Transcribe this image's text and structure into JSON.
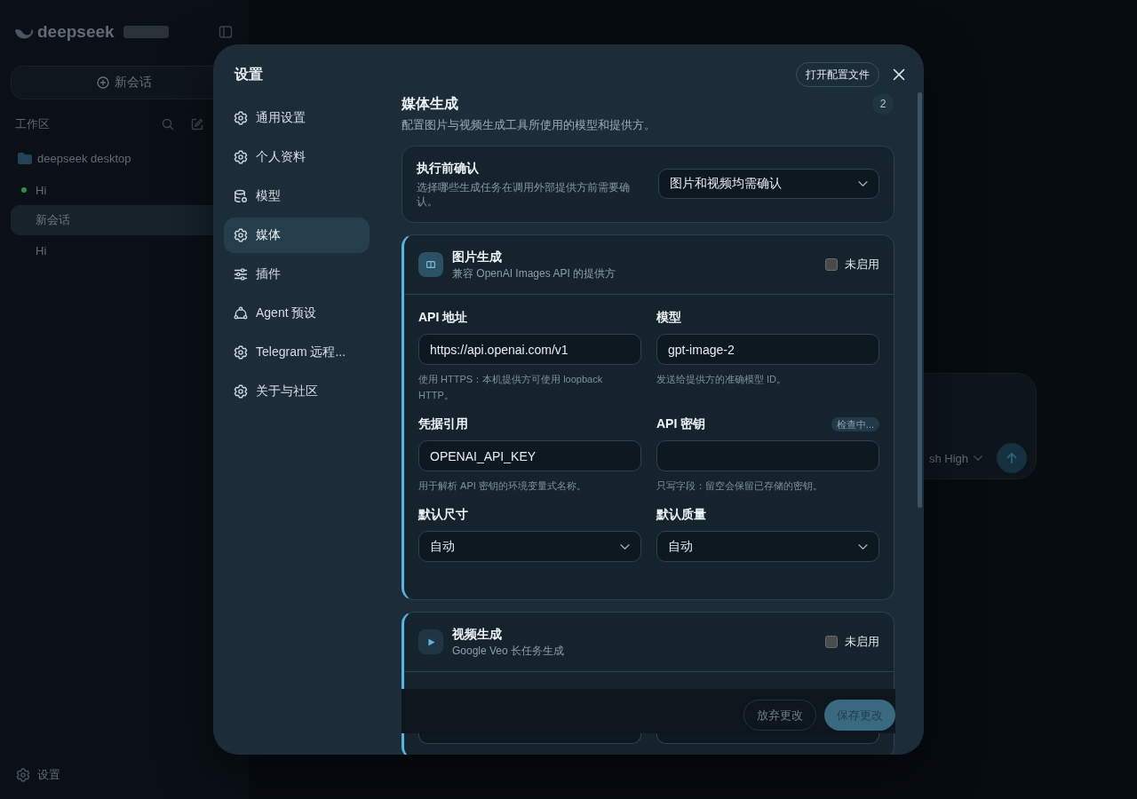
{
  "background": {
    "sidebar": {
      "brand": "deepseek",
      "new_chat_button": "新会话",
      "section_title": "工作区",
      "project": "deepseek desktop",
      "conversations": [
        {
          "title": "Hi",
          "selected": false,
          "color": "#2f8f3f"
        },
        {
          "title": "新会话",
          "selected": true
        },
        {
          "title": "Hi",
          "selected": false
        }
      ],
      "settings_link": "设置"
    },
    "composer": {
      "model_selector": "sh High"
    }
  },
  "dialog": {
    "title": "设置",
    "nav": [
      {
        "kind": "gear",
        "label": "通用设置",
        "selected": false
      },
      {
        "kind": "gear",
        "label": "个人资料",
        "selected": false
      },
      {
        "kind": "database",
        "label": "模型",
        "selected": false
      },
      {
        "kind": "gear",
        "label": "媒体",
        "selected": true
      },
      {
        "kind": "sliders",
        "label": "插件",
        "selected": false
      },
      {
        "kind": "cycle",
        "label": "Agent 预设",
        "selected": false
      },
      {
        "kind": "gear",
        "label": "Telegram 远程...",
        "selected": false
      },
      {
        "kind": "gear",
        "label": "关于与社区",
        "selected": false
      }
    ],
    "open_config_button": "打开配置文件",
    "section": {
      "title": "媒体生成",
      "description": "配置图片与视频生成工具所使用的模型和提供方。",
      "badge": "2"
    },
    "confirm_card": {
      "title": "执行前确认",
      "description": "选择哪些生成任务在调用外部提供方前需要确认。",
      "value": "图片和视频均需确认"
    },
    "providers": [
      {
        "kind": "image",
        "title": "图片生成",
        "subtitle": "兼容 OpenAI Images API 的提供方",
        "enabled": false,
        "enabled_label": "未启用",
        "fields": [
          {
            "kind": "text",
            "label": "API 地址",
            "value": "https://api.openai.com/v1",
            "hint": "使用 HTTPS：本机提供方可使用 loopback HTTP。"
          },
          {
            "kind": "text",
            "label": "模型",
            "value": "gpt-image-2",
            "hint": "发送给提供方的准确模型 ID。"
          },
          {
            "kind": "text",
            "label": "凭据引用",
            "value": "OPENAI_API_KEY",
            "hint": "用于解析 API 密钥的环境变量式名称。"
          },
          {
            "kind": "text",
            "label": "API 密钥",
            "status": "检查中...",
            "hint": "只写字段：留空会保留已存储的密钥。"
          },
          {
            "kind": "select",
            "label": "默认尺寸",
            "value": "自动"
          },
          {
            "kind": "select",
            "label": "默认质量",
            "value": "自动"
          }
        ]
      },
      {
        "kind": "video",
        "title": "视频生成",
        "subtitle": "Google Veo 长任务生成",
        "enabled": false,
        "enabled_label": "未启用"
      }
    ],
    "footer": {
      "buttons": [
        {
          "kind": "secondary",
          "label": "放弃更改",
          "disabled": true
        },
        {
          "kind": "primary",
          "label": "保存更改",
          "disabled": true
        }
      ]
    }
  }
}
